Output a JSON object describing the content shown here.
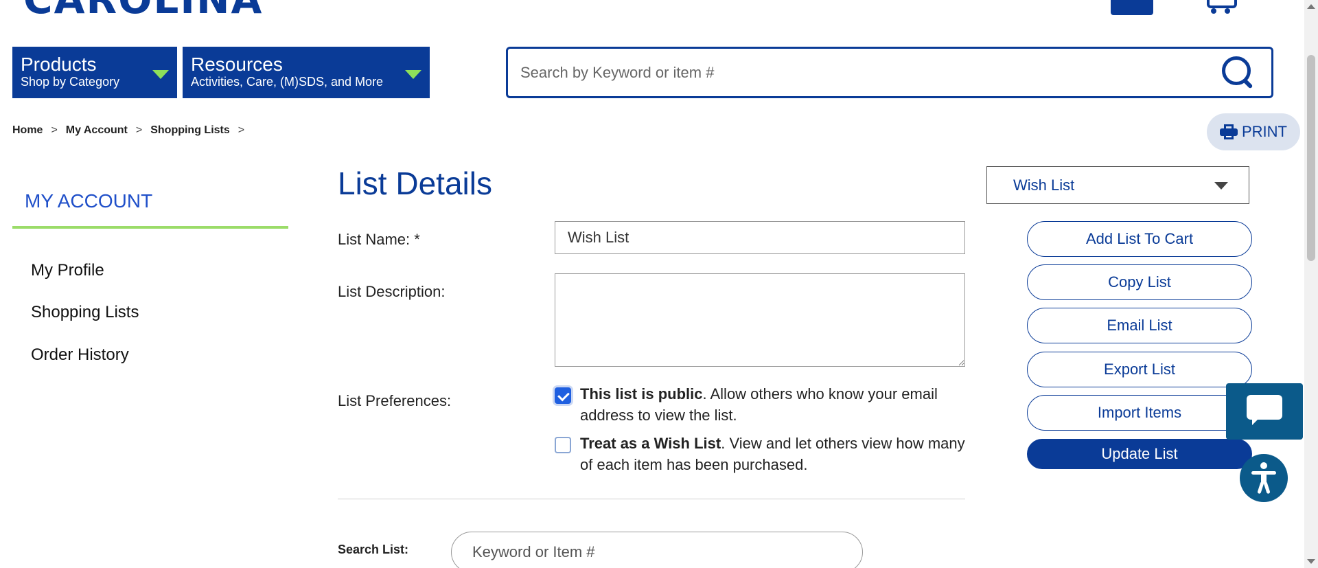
{
  "header": {
    "logo_text": "CAROLINA",
    "nav": [
      {
        "title": "Products",
        "subtitle": "Shop by Category"
      },
      {
        "title": "Resources",
        "subtitle": "Activities, Care, (M)SDS, and More"
      }
    ],
    "search_placeholder": "Search by Keyword or item #"
  },
  "breadcrumb": {
    "items": [
      "Home",
      "My Account",
      "Shopping Lists"
    ],
    "separator": ">"
  },
  "print_label": "PRINT",
  "sidebar": {
    "title": "MY ACCOUNT",
    "items": [
      "My Profile",
      "Shopping Lists",
      "Order History"
    ]
  },
  "main": {
    "title": "List Details",
    "list_name_label": "List Name: *",
    "list_name_value": "Wish List",
    "list_description_label": "List Description:",
    "list_description_value": "",
    "list_preferences_label": "List Preferences:",
    "pref_public_bold": "This list is public",
    "pref_public_rest": ". Allow others who know your email address to view the list.",
    "pref_public_checked": true,
    "pref_wish_bold": "Treat as a Wish List",
    "pref_wish_rest": ". View and let others view how many of each item has been purchased.",
    "pref_wish_checked": false,
    "search_list_label": "Search List:",
    "search_list_placeholder": "Keyword or Item #"
  },
  "right_panel": {
    "selected_list": "Wish List",
    "buttons": [
      "Add List To Cart",
      "Copy List",
      "Email List",
      "Export List",
      "Import Items"
    ],
    "primary_button": "Update List"
  },
  "colors": {
    "brand_blue": "#0a3b97",
    "accent_green": "#9bdc69",
    "sidebar_title": "#1f4fc9",
    "chat_widget": "#0b5a8a"
  }
}
